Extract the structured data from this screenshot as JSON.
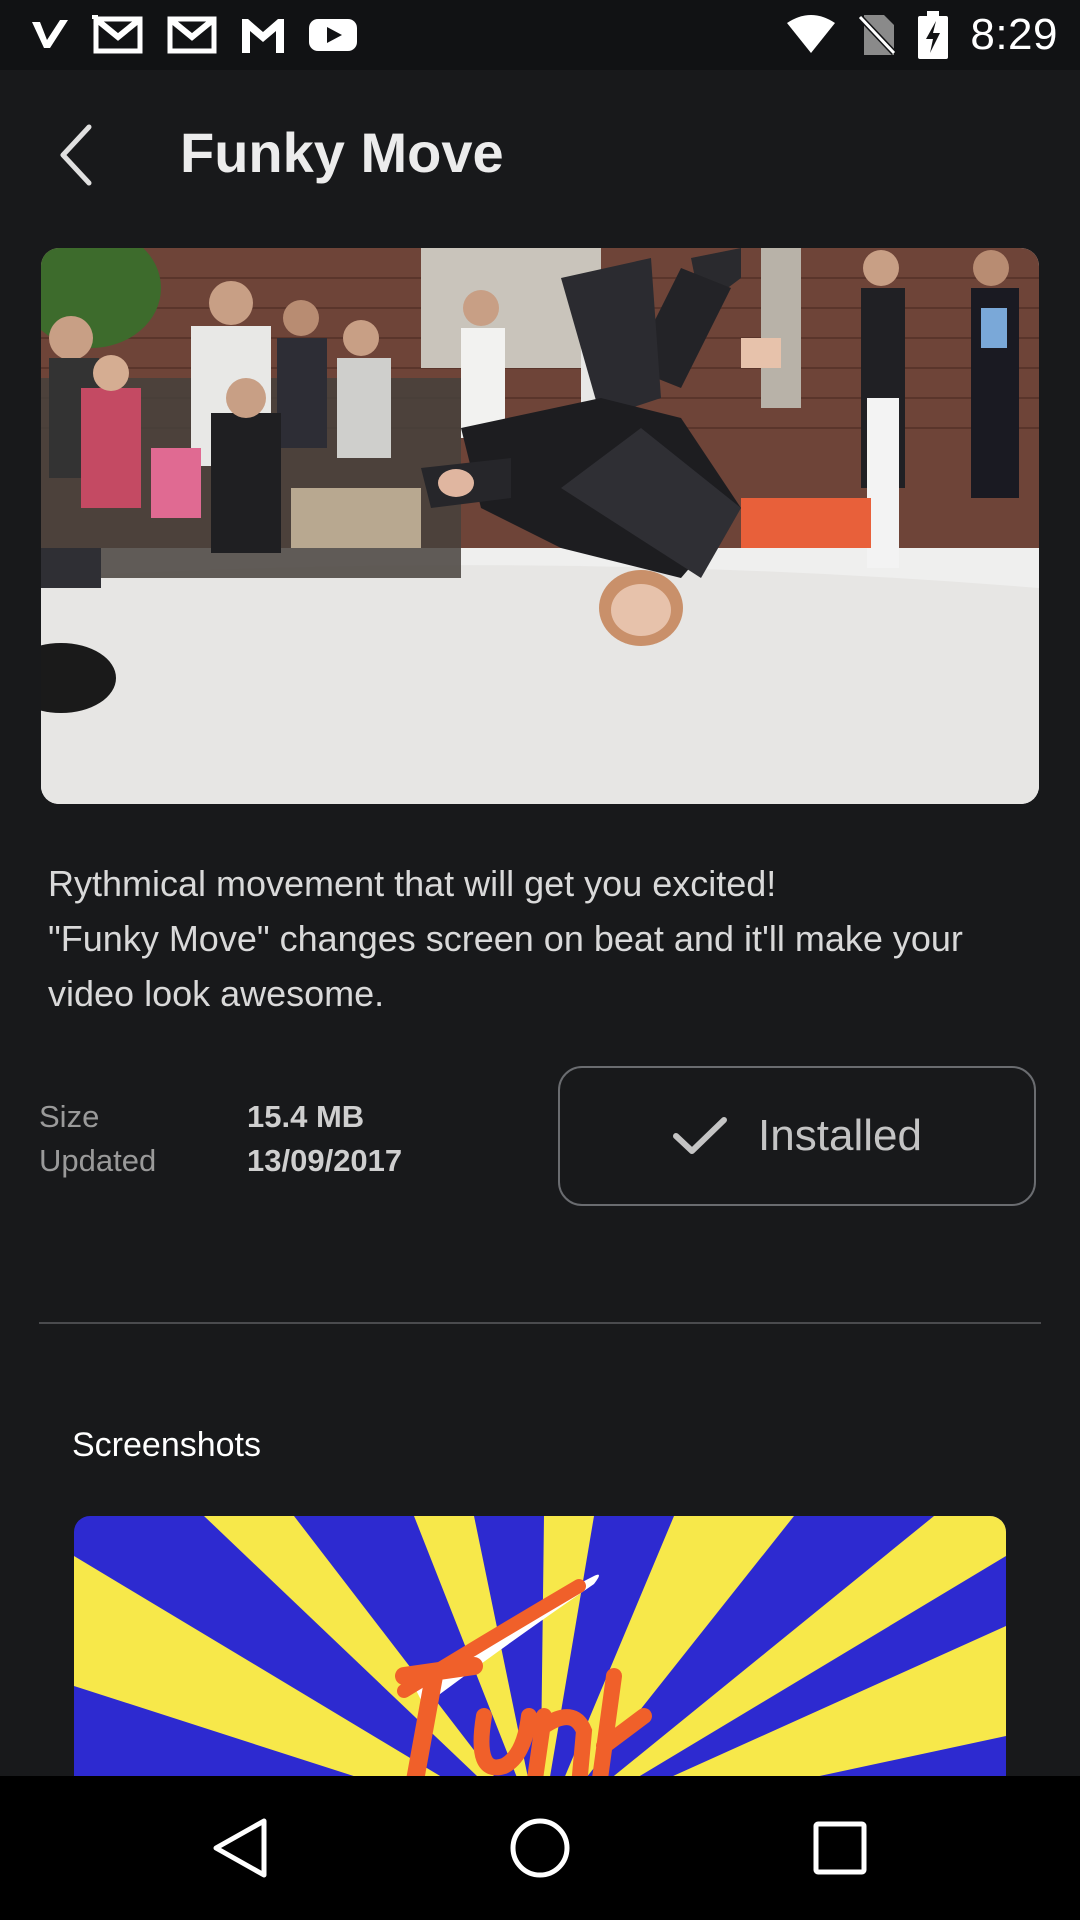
{
  "status_bar": {
    "time": "8:29",
    "left_icons": [
      "v-app-icon",
      "gmail-icon",
      "gmail-icon",
      "gmail-icon",
      "youtube-icon"
    ],
    "right_icons": [
      "wifi-icon",
      "no-sim-icon",
      "battery-charging-icon"
    ]
  },
  "header": {
    "title": "Funky Move",
    "back_icon": "chevron-left-icon"
  },
  "description": {
    "line1": "Rythmical movement that will get you excited!",
    "line2": "\"Funky Move\" changes screen on beat and it'll make your video look awesome."
  },
  "meta": {
    "size_label": "Size",
    "size_value": "15.4 MB",
    "updated_label": "Updated",
    "updated_value": "13/09/2017"
  },
  "install_button": {
    "label": "Installed",
    "icon": "checkmark-icon"
  },
  "screenshots": {
    "heading": "Screenshots"
  },
  "nav_bar": {
    "icons": [
      "back-triangle-icon",
      "home-circle-icon",
      "recents-square-icon"
    ]
  },
  "colors": {
    "background": "#18191b",
    "status_bar": "#111214",
    "nav_bar": "#000000",
    "title_text": "#ececec",
    "button_border": "#6a6c70",
    "thumb_yellow": "#f7e84a",
    "thumb_blue": "#2d2ad0",
    "thumb_orange": "#f0602a"
  }
}
